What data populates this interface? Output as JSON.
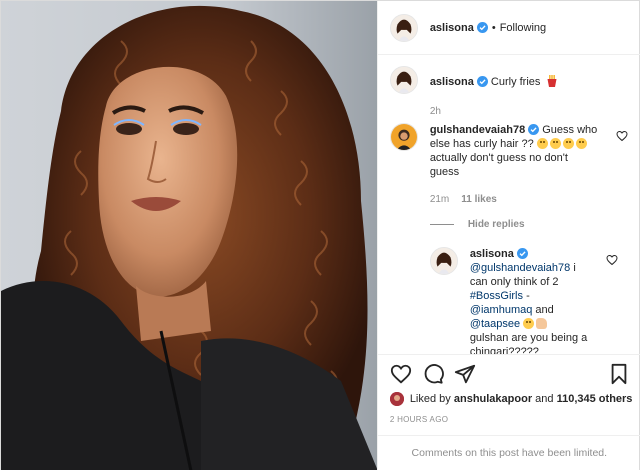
{
  "header": {
    "username": "aslisona",
    "separator": "•",
    "follow_status": "Following"
  },
  "caption": {
    "username": "aslisona",
    "text": "Curly fries",
    "time": "2h"
  },
  "comments": [
    {
      "username": "gulshandevaiah78",
      "text": "Guess who else has curly hair ??",
      "text_cont": "actually don't guess no don't guess",
      "time": "21m",
      "likes": "11 likes"
    }
  ],
  "hide_replies_label": "Hide replies",
  "reply": {
    "username": "aslisona",
    "mention1": "@gulshandevaiah78",
    "text1": "i can only think of 2",
    "mention2": "#BossGirls",
    "text2": "-",
    "mention3": "@iamhumaq",
    "text3": "and",
    "mention4": "@taapsee",
    "text4": "gulshan are you being a chingari?????"
  },
  "likes": {
    "prefix": "Liked by",
    "liker": "anshulakapoor",
    "conjunction": "and",
    "others": "110,345 others"
  },
  "timestamp": "2 HOURS AGO",
  "comments_limited": "Comments on this post have been limited.",
  "icons": {
    "verified": "verified-badge-icon",
    "heart": "heart-icon",
    "comment": "comment-icon",
    "share": "share-icon",
    "save": "bookmark-icon",
    "fries": "fries-emoji-icon"
  },
  "colors": {
    "verified": "#3897f0",
    "text": "#262626",
    "muted": "#8e8e8e",
    "border": "#efefef",
    "link": "#00376b"
  }
}
